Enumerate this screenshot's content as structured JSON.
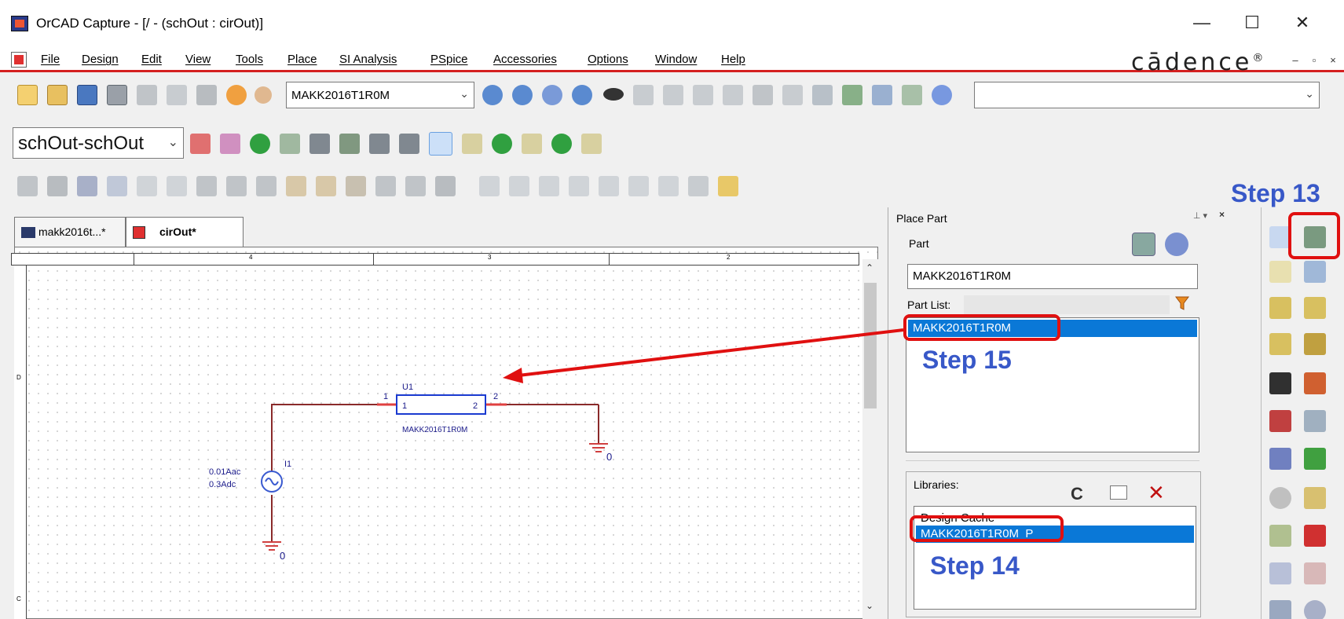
{
  "window": {
    "title": "OrCAD Capture - [/ - (schOut : cirOut)]",
    "minimize": "—",
    "maximize": "☐",
    "close": "✕"
  },
  "menu": {
    "items": [
      "File",
      "Design",
      "Edit",
      "View",
      "Tools",
      "Place",
      "SI Analysis",
      "PSpice",
      "Accessories",
      "Options",
      "Window",
      "Help"
    ],
    "brand": "cādence",
    "brand_mark": "®"
  },
  "toolbar1": {
    "part_combo_value": "MAKK2016T1R0M",
    "search_combo_value": ""
  },
  "toolbar2": {
    "profile_combo_value": "schOut-schOut"
  },
  "tabs": [
    {
      "label": "makk2016t...*",
      "active": false
    },
    {
      "label": "cirOut*",
      "active": true
    }
  ],
  "ruler": {
    "ticks": [
      "4",
      "3",
      "2"
    ]
  },
  "schematic": {
    "row_markers": [
      "D",
      "C"
    ],
    "part_ref": "U1",
    "part_value": "MAKK2016T1R0M",
    "pin1_outer": "1",
    "pin1_inner": "1",
    "pin2_outer": "2",
    "pin2_inner": "2",
    "source_ref": "I1",
    "source_ac": "0.01Aac",
    "source_dc": "0.3Adc",
    "gnd_label_1": "0",
    "gnd_label_2": "0"
  },
  "place_part": {
    "title": "Place Part",
    "part_label": "Part",
    "part_value": "MAKK2016T1R0M",
    "part_list_label": "Part List:",
    "part_list_items": [
      "MAKK2016T1R0M"
    ],
    "libraries_label": "Libraries:",
    "libraries_items": [
      "Design Cache",
      "MAKK2016T1R0M_P"
    ]
  },
  "annotations": {
    "step13": "Step 13",
    "step14": "Step 14",
    "step15": "Step 15"
  },
  "colors": {
    "accent_red": "#e01010",
    "step_blue": "#3858c8",
    "selection_blue": "#0a78d7"
  }
}
